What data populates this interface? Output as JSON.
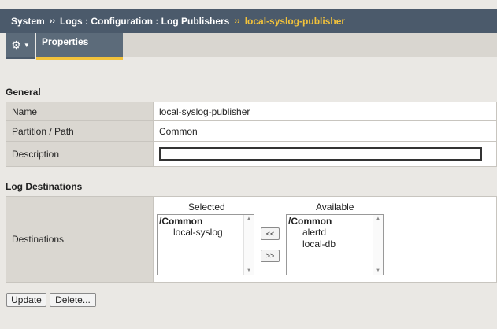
{
  "breadcrumb": {
    "root": "System",
    "path": "Logs : Configuration : Log Publishers",
    "current": "local-syslog-publisher",
    "separator": "››"
  },
  "tabs": {
    "properties": "Properties"
  },
  "general": {
    "title": "General",
    "name_label": "Name",
    "name_value": "local-syslog-publisher",
    "partition_label": "Partition / Path",
    "partition_value": "Common",
    "description_label": "Description",
    "description_value": ""
  },
  "log_destinations": {
    "title": "Log Destinations",
    "destinations_label": "Destinations",
    "selected_header": "Selected",
    "available_header": "Available",
    "selected_group": "/Common",
    "selected_items": [
      "local-syslog"
    ],
    "available_group": "/Common",
    "available_items": [
      "alertd",
      "local-db"
    ],
    "move_left": "<<",
    "move_right": ">>"
  },
  "actions": {
    "update": "Update",
    "delete": "Delete..."
  },
  "colors": {
    "header_bg": "#4b5a6b",
    "accent": "#f2c23b",
    "page_bg": "#eae8e4"
  }
}
